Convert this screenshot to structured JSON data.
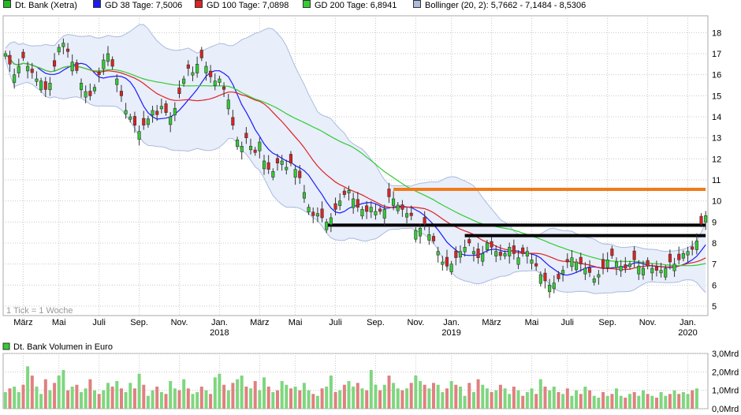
{
  "legend": [
    {
      "label": "Dt. Bank (Xetra)",
      "color": "#22bb22"
    },
    {
      "label": "GD 38 Tage: 7,5006",
      "color": "#1a1aff"
    },
    {
      "label": "GD 100 Tage: 7,0898",
      "color": "#dd2222"
    },
    {
      "label": "GD 200 Tage: 6,8941",
      "color": "#33cc33"
    },
    {
      "label": "Bollinger (20, 2): 5,7662 - 7,1484 - 8,5306",
      "color": "#aabbdd"
    }
  ],
  "tick_note": "1 Tick = 1 Woche",
  "volume_title": "Dt. Bank Volumen in Euro",
  "chart_data": [
    {
      "type": "candlestick",
      "title": "Dt. Bank (Xetra)",
      "y_ticks": [
        "5",
        "6",
        "7",
        "8",
        "9",
        "10",
        "11",
        "12",
        "13",
        "14",
        "15",
        "16",
        "17",
        "18"
      ],
      "ylim": [
        4.55,
        18.8
      ],
      "x_ticks": [
        {
          "label": "März",
          "week": 4
        },
        {
          "label": "Mai",
          "week": 12
        },
        {
          "label": "Juli",
          "week": 21
        },
        {
          "label": "Sep.",
          "week": 30
        },
        {
          "label": "Nov.",
          "week": 39
        },
        {
          "label": "Jan.",
          "year": "2018",
          "week": 48
        },
        {
          "label": "März",
          "week": 57
        },
        {
          "label": "Mai",
          "week": 65
        },
        {
          "label": "Juli",
          "week": 74
        },
        {
          "label": "Sep.",
          "week": 83
        },
        {
          "label": "Nov.",
          "week": 92
        },
        {
          "label": "Jan.",
          "year": "2019",
          "week": 100
        },
        {
          "label": "März",
          "week": 109
        },
        {
          "label": "Mai",
          "week": 118
        },
        {
          "label": "Juli",
          "week": 126
        },
        {
          "label": "Sep.",
          "week": 135
        },
        {
          "label": "Nov.",
          "week": 144
        },
        {
          "label": "Jan.",
          "year": "2020",
          "week": 153
        }
      ],
      "weeks": 158,
      "close": [
        17.0,
        16.5,
        16.0,
        16.4,
        16.8,
        16.4,
        16.1,
        15.8,
        15.7,
        15.3,
        15.6,
        16.4,
        17.3,
        17.5,
        17.1,
        16.6,
        16.2,
        15.6,
        15.2,
        15.0,
        15.4,
        16.0,
        16.7,
        17.0,
        16.4,
        15.8,
        15.0,
        14.3,
        14.0,
        13.6,
        13.3,
        13.6,
        13.9,
        14.3,
        14.1,
        14.5,
        14.2,
        14.0,
        14.4,
        15.1,
        15.8,
        16.3,
        16.1,
        16.5,
        16.8,
        16.4,
        15.9,
        15.7,
        15.8,
        15.3,
        14.8,
        13.6,
        12.9,
        12.6,
        13.0,
        12.6,
        12.3,
        12.8,
        11.9,
        11.5,
        11.4,
        11.8,
        11.9,
        11.6,
        11.8,
        11.5,
        11.1,
        10.4,
        9.7,
        9.3,
        9.4,
        9.2,
        9.0,
        9.2,
        9.6,
        10.0,
        10.3,
        10.5,
        10.1,
        9.7,
        9.6,
        9.5,
        9.7,
        9.5,
        9.5,
        9.6,
        10.2,
        10.1,
        9.8,
        9.6,
        9.4,
        9.3,
        8.6,
        8.7,
        8.9,
        8.4,
        8.1,
        7.6,
        7.1,
        6.9,
        7.0,
        7.3,
        7.6,
        7.8,
        8.0,
        7.6,
        7.3,
        7.5,
        8.0,
        7.8,
        7.6,
        7.4,
        7.5,
        7.8,
        7.5,
        7.3,
        7.5,
        7.6,
        7.2,
        6.9,
        6.5,
        6.2,
        6.0,
        6.1,
        6.3,
        6.7,
        7.1,
        7.3,
        7.1,
        7.0,
        6.8,
        6.6,
        6.3,
        6.5,
        6.8,
        7.2,
        7.4,
        7.1,
        6.9,
        6.8,
        7.0,
        7.2,
        6.9,
        6.8,
        6.9,
        6.8,
        6.7,
        6.7,
        6.8,
        7.1,
        7.0,
        7.2,
        7.5,
        7.6,
        7.7,
        8.1,
        8.9,
        9.3
      ],
      "moving_averages": [
        {
          "name": "GD 38 Tage",
          "color": "#1a1aff",
          "window": 8
        },
        {
          "name": "GD 100 Tage",
          "color": "#dd2222",
          "window": 20
        },
        {
          "name": "GD 200 Tage",
          "color": "#33cc33",
          "window": 40
        }
      ],
      "bollinger": {
        "name": "Bollinger (20, 2)",
        "period": 20,
        "k": 2,
        "color": "#aabbdd",
        "fill": "#e8eefa"
      },
      "support_resistance_lines": [
        {
          "color": "#f07a1a",
          "y": 10.55,
          "from_week": 87,
          "to_week": 157
        },
        {
          "color": "#000000",
          "y": 8.85,
          "from_week": 72,
          "to_week": 157
        },
        {
          "color": "#000000",
          "y": 8.35,
          "from_week": 103,
          "to_week": 157
        }
      ],
      "up_color": "#33cc33",
      "down_color": "#dd2222"
    },
    {
      "type": "bar",
      "title": "Dt. Bank Volumen in Euro",
      "y_ticks": [
        "3,0Mrd",
        "2,0Mrd",
        "1,0Mrd",
        "0,0Mrd"
      ],
      "ylim": [
        0,
        3.0
      ],
      "unit": "Mrd",
      "values": [
        0.9,
        1.1,
        1.2,
        0.9,
        1.3,
        2.3,
        1.8,
        1.2,
        0.8,
        1.6,
        1.0,
        1.4,
        1.8,
        2.1,
        1.0,
        1.2,
        1.3,
        0.9,
        1.1,
        1.6,
        1.0,
        0.8,
        1.0,
        1.4,
        1.2,
        1.5,
        1.1,
        0.9,
        1.4,
        1.1,
        1.9,
        1.3,
        0.7,
        1.0,
        1.2,
        0.9,
        0.8,
        1.5,
        1.1,
        1.0,
        1.6,
        1.1,
        0.8,
        0.9,
        1.2,
        1.0,
        0.8,
        1.7,
        1.9,
        1.3,
        1.0,
        1.4,
        1.6,
        1.8,
        1.2,
        1.1,
        1.5,
        1.0,
        1.7,
        1.2,
        0.9,
        1.0,
        1.5,
        1.3,
        1.1,
        1.2,
        1.0,
        1.4,
        1.0,
        0.8,
        0.7,
        1.1,
        1.2,
        1.8,
        0.9,
        1.0,
        1.3,
        1.5,
        1.2,
        1.4,
        1.1,
        1.0,
        2.1,
        1.3,
        1.0,
        1.3,
        1.8,
        1.4,
        1.1,
        1.0,
        1.1,
        1.4,
        1.8,
        1.5,
        1.3,
        1.1,
        1.4,
        1.3,
        0.9,
        1.1,
        1.5,
        1.3,
        1.2,
        0.7,
        1.4,
        0.9,
        1.6,
        1.3,
        1.1,
        0.9,
        1.0,
        1.3,
        1.1,
        0.8,
        1.2,
        1.0,
        0.7,
        0.9,
        1.1,
        0.8,
        1.6,
        1.2,
        1.0,
        1.2,
        0.9,
        0.8,
        1.1,
        0.7,
        1.0,
        0.8,
        1.2,
        1.0,
        0.7,
        0.6,
        0.9,
        0.7,
        0.8,
        1.1,
        0.7,
        0.6,
        0.8,
        0.9,
        0.7,
        1.0,
        0.8,
        0.7,
        0.6,
        0.9,
        0.7,
        0.8,
        1.0,
        0.8,
        0.9,
        0.8,
        1.0,
        1.1
      ]
    }
  ]
}
